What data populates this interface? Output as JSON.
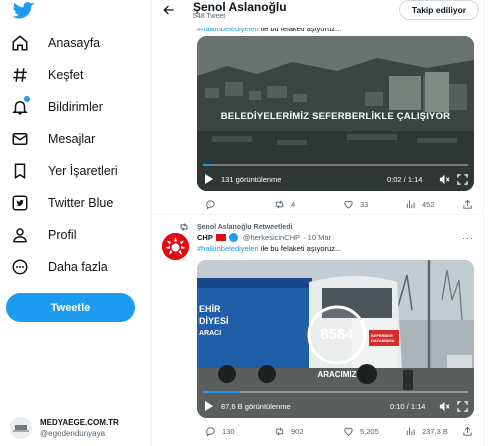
{
  "sidebar": {
    "items": [
      {
        "label": "Anasayfa",
        "icon": "home-icon"
      },
      {
        "label": "Keşfet",
        "icon": "hashtag-icon"
      },
      {
        "label": "Bildirimler",
        "icon": "bell-icon"
      },
      {
        "label": "Mesajlar",
        "icon": "mail-icon"
      },
      {
        "label": "Yer İşaretleri",
        "icon": "bookmark-icon"
      },
      {
        "label": "Twitter Blue",
        "icon": "twitter-blue-icon"
      },
      {
        "label": "Profil",
        "icon": "profile-icon"
      },
      {
        "label": "Daha fazla",
        "icon": "more-circle-icon"
      }
    ],
    "tweet_button": "Tweetle",
    "account": {
      "name": "MEDYAEGE.COM.TR",
      "handle": "@egedendunyaya"
    }
  },
  "header": {
    "name": "Şenol Aslanoğlu",
    "tweet_count": "548 Tweet",
    "follow_button": "Takip ediliyor"
  },
  "tweets": [
    {
      "text_hashtag": "#halkinbelediyeleri",
      "text_rest": " ile bu felaketi aşıyoruz...",
      "video": {
        "overlay": "BELEDİYELERİMİZ SEFERBERLİKLE ÇALIŞIYOR",
        "views": "131 görüntülenme",
        "time": "0:02 / 1:14",
        "progress": 0.03
      },
      "actions": {
        "replies": "",
        "retweets": "4",
        "likes": "33",
        "views": "452"
      }
    },
    {
      "retweeted_by": "Şenol Aslanoğlu Retweetledi",
      "author_name": "CHP",
      "author_handle": "@herkesicinCHP",
      "date": "· 10 Mar",
      "text_hashtag": "#halkinbelediyeleri",
      "text_rest": " ile bu felaketi aşıyoruz...",
      "video": {
        "truck_number": "8584",
        "caption": "ARACIMIZ",
        "truck_text_1": "EHİR",
        "truck_text_2": "DİYESİ",
        "truck_text_3": "ARACI",
        "cab_text": "SEFERBER DAYANIŞMA",
        "views": "87,6 B görüntülenme",
        "time": "0:10 / 1:14",
        "progress": 0.14
      },
      "actions": {
        "replies": "130",
        "retweets": "902",
        "likes": "5.205",
        "views": "237,3 B"
      }
    }
  ],
  "colors": {
    "accent": "#1d9bf0",
    "chp_red": "#e30a17",
    "text": "#0f1419",
    "muted": "#536471"
  }
}
